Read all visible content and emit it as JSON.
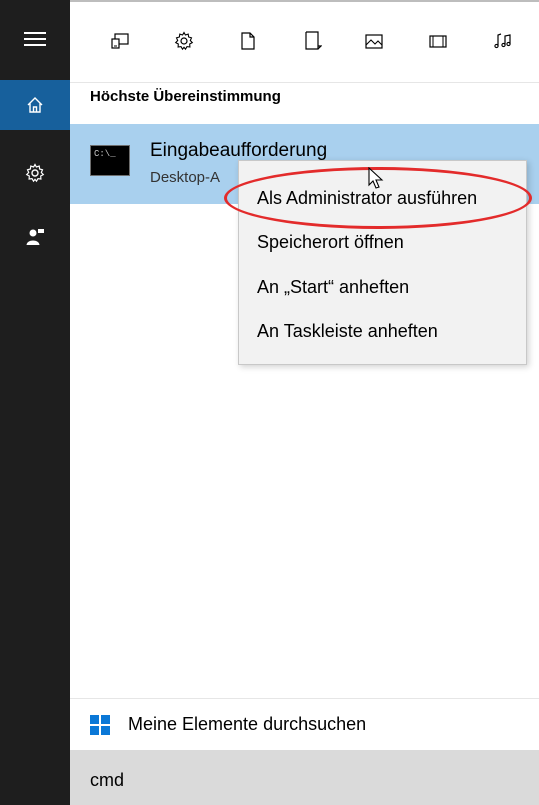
{
  "rail": {
    "items": [
      {
        "name": "menu",
        "icon": "hamburger-icon"
      },
      {
        "name": "home",
        "icon": "home-icon",
        "active": true
      },
      {
        "name": "settings",
        "icon": "gear-icon"
      },
      {
        "name": "feedback",
        "icon": "feedback-person-icon"
      }
    ]
  },
  "filters": [
    {
      "icon": "apps-icon"
    },
    {
      "icon": "settings-icon"
    },
    {
      "icon": "document-icon"
    },
    {
      "icon": "folder-icon"
    },
    {
      "icon": "photos-icon"
    },
    {
      "icon": "videos-icon"
    },
    {
      "icon": "music-icon"
    }
  ],
  "results": {
    "section_title": "Höchste Übereinstimmung",
    "best_match": {
      "title": "Eingabeaufforderung",
      "subtitle": "Desktop-A",
      "icon_text": "C:\\_"
    }
  },
  "context_menu": {
    "items": [
      "Als Administrator ausführen",
      "Speicherort öffnen",
      "An „Start“ anheften",
      "An Taskleiste anheften"
    ]
  },
  "bottom": {
    "search_mine_label": "Meine Elemente durchsuchen",
    "query": "cmd"
  },
  "colors": {
    "rail_bg": "#1e1e1e",
    "rail_active": "#17609c",
    "selection": "#a9d0ee",
    "annotation": "#e32b2b",
    "windows_blue": "#0a78d7"
  }
}
